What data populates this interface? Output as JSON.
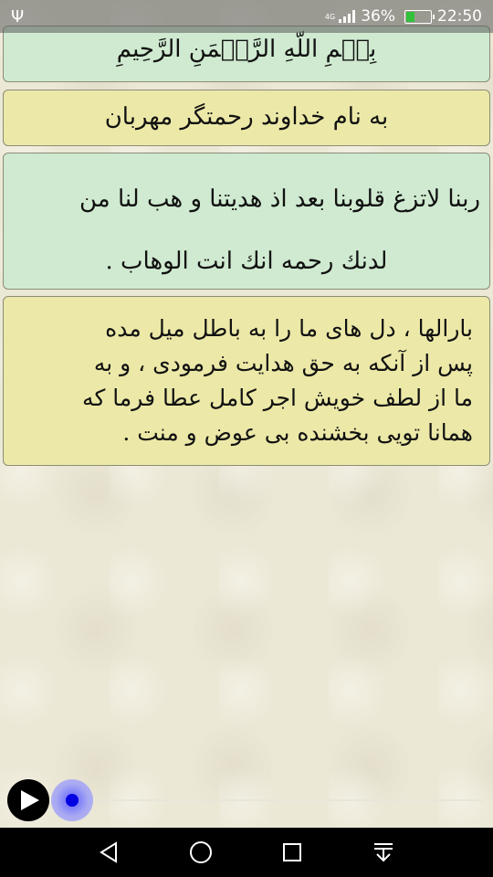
{
  "status_bar": {
    "usb_icon": "usb-icon",
    "network_type": "4G",
    "battery_percent": "36%",
    "battery_level": 0.36,
    "time": "22:50"
  },
  "cards": [
    {
      "text": "بِسۡمِ اللّهِ الرَّحۡمَنِ الرَّحِيمِ",
      "color": "#cfead0"
    },
    {
      "text": "به نام خداوند رحمتگر مهربان",
      "color": "#ece9a8"
    },
    {
      "line1": "ربنا لاتزغ قلوبنا بعد اذ هديتنا و هب لنا من",
      "line2": "لدنك رحمه انك انت الوهاب .",
      "color": "#cfead0"
    },
    {
      "lines": [
        "بارالها ، دل های ما را به باطل میل مده",
        "پس از آنکه به حق هدایت فرمودی ، و به",
        "ما از لطف خویش اجر کامل عطا فرما که",
        "همانا تویی بخشنده بی عوض و منت ."
      ],
      "color": "#ece9a8"
    }
  ],
  "player": {
    "play_icon": "play-icon",
    "progress": 0.0
  },
  "nav": {
    "back_icon": "back-triangle-icon",
    "home_icon": "home-circle-icon",
    "recents_icon": "recents-square-icon",
    "notifications_icon": "notification-pull-icon"
  }
}
